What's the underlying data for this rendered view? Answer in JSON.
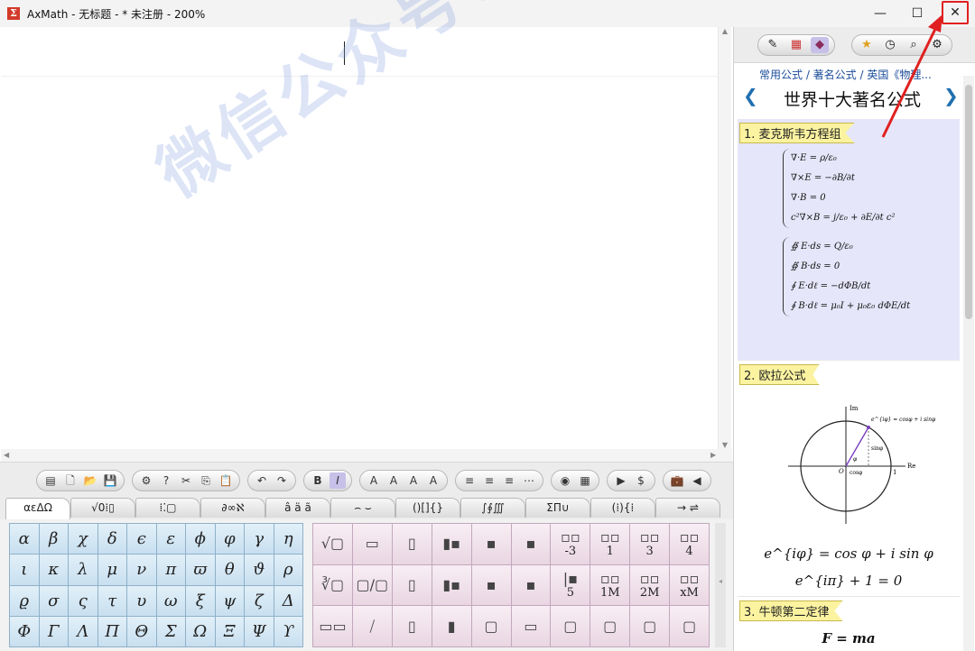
{
  "window": {
    "title": "AxMath - 无标题 - * 未注册 - 200%",
    "minimize": "—",
    "maximize": "☐",
    "close": "✕"
  },
  "toolbar": {
    "groups": [
      [
        "▤",
        "🗋",
        "📂",
        "💾"
      ],
      [
        "⚙",
        "?",
        "✂",
        "⎘",
        "📋"
      ],
      [
        "↶",
        "↷"
      ],
      [
        "B",
        "I"
      ],
      [
        "A",
        "A",
        "A",
        "A"
      ],
      [
        "≡",
        "≡",
        "≡",
        "⋯"
      ],
      [
        "◉",
        "▦"
      ],
      [
        "▶",
        "$"
      ],
      [
        "💼",
        "◀"
      ]
    ]
  },
  "category_tabs": [
    "αεΔΩ",
    "√0⁞▯",
    "⁞⁚▢",
    "∂∞ℵ",
    "â ä ã",
    "⌢ ⌣",
    "()[]{}",
    "∫∮∭",
    "ΣΠ∪",
    "(⁞){⁞",
    "→ ⇌"
  ],
  "greek": [
    [
      "α",
      "β",
      "χ",
      "δ",
      "ϵ",
      "ε",
      "ϕ",
      "φ",
      "γ",
      "η"
    ],
    [
      "ι",
      "κ",
      "λ",
      "μ",
      "ν",
      "π",
      "ϖ",
      "θ",
      "ϑ",
      "ρ"
    ],
    [
      "ϱ",
      "σ",
      "ς",
      "τ",
      "υ",
      "ω",
      "ξ",
      "ψ",
      "ζ",
      "Δ"
    ],
    [
      "Φ",
      "Γ",
      "Λ",
      "Π",
      "Θ",
      "Σ",
      "Ω",
      "Ξ",
      "Ψ",
      "ϒ"
    ]
  ],
  "templates": [
    [
      "√▯",
      "▯/▯",
      "▮",
      "▮▪",
      "▯",
      "▮▪",
      "▪▫",
      "-3",
      "1",
      "3",
      "4"
    ],
    [
      "∛▯",
      "▯/▯",
      "▮",
      "▮▪",
      "▮",
      "▮",
      "|▪",
      "5",
      "1M",
      "2M",
      "xM"
    ],
    [
      "▯▯",
      "⁄",
      "▮",
      "▮",
      "▯",
      "▭",
      "▢",
      "▢",
      "▢",
      "▢"
    ]
  ],
  "template_labels": {
    "r0": [
      "",
      "",
      "",
      "",
      "",
      "",
      "-3",
      "1",
      "3",
      "4"
    ],
    "r1": [
      "",
      "",
      "",
      "",
      "",
      "",
      "5",
      "1M",
      "2M",
      "xM"
    ]
  },
  "panel": {
    "breadcrumb": "常用公式 / 著名公式 / 英国《物理...",
    "title": "世界十大著名公式",
    "prev": "❮",
    "next": "❯",
    "sections": [
      {
        "title": "1. 麦克斯韦方程组"
      },
      {
        "title": "2. 欧拉公式"
      },
      {
        "title": "3. 牛顿第二定律"
      }
    ],
    "maxwell_diff": [
      "∇·E = ρ/ε₀",
      "∇×E = −∂B/∂t",
      "∇·B = 0",
      "c²∇×B = j/ε₀ + ∂E/∂t c²"
    ],
    "maxwell_int": [
      "∯ E·ds = Q/ε₀",
      "∯ B·ds = 0",
      "∮ E·dℓ = −dΦB/dt",
      "∮ B·dℓ = μ₀I + μ₀ε₀ dΦE/dt"
    ],
    "euler_1": "e^{iφ} = cos φ + i sin φ",
    "euler_2": "e^{iπ} + 1 = 0",
    "newton": "F = ma",
    "diagram": {
      "im": "Im",
      "re": "Re",
      "origin": "O",
      "one": "1",
      "cos": "cosφ",
      "sin": "sinφ",
      "phi": "φ",
      "eq": "e^{iφ} = cosφ + i sinφ"
    }
  },
  "watermark": "微信公众号：不迷路资源库"
}
